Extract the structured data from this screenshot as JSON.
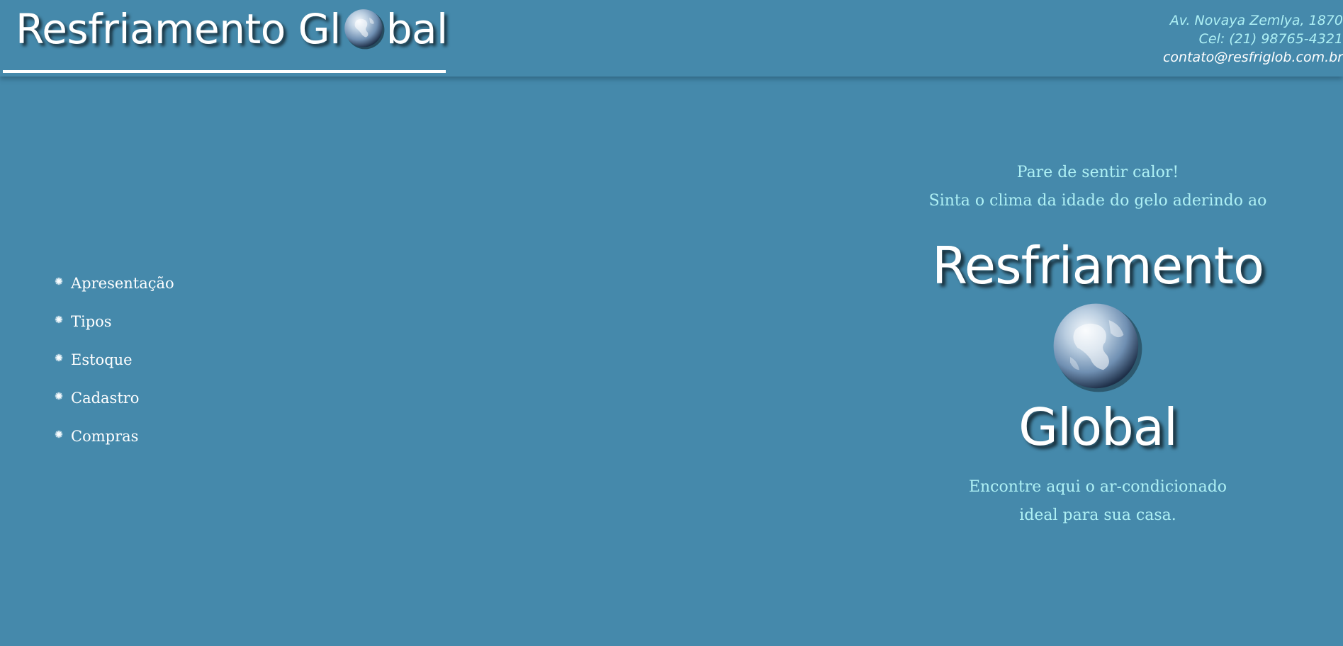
{
  "header": {
    "logo_part1": "Resfriamento Gl",
    "logo_part2": "bal",
    "contact": {
      "address": "Av. Novaya Zemlya, 1870",
      "phone": "Cel: (21) 98765-4321",
      "email": "contato@resfriglob.com.br"
    }
  },
  "nav": {
    "items": [
      {
        "label": "Apresentação"
      },
      {
        "label": "Tipos"
      },
      {
        "label": "Estoque"
      },
      {
        "label": "Cadastro"
      },
      {
        "label": "Compras"
      }
    ],
    "bullet_icon": "snowflake-bullet-icon"
  },
  "promo": {
    "line1": "Pare de sentir calor!",
    "line2": "Sinta o clima da idade do gelo aderindo ao",
    "brand_word1": "Resfriamento",
    "brand_word2": "Global",
    "tagline1": "Encontre aqui o ar-condicionado",
    "tagline2": "ideal para sua casa."
  },
  "colors": {
    "background": "#4589ab",
    "accent_text": "#aef0f4",
    "white": "#ffffff"
  }
}
